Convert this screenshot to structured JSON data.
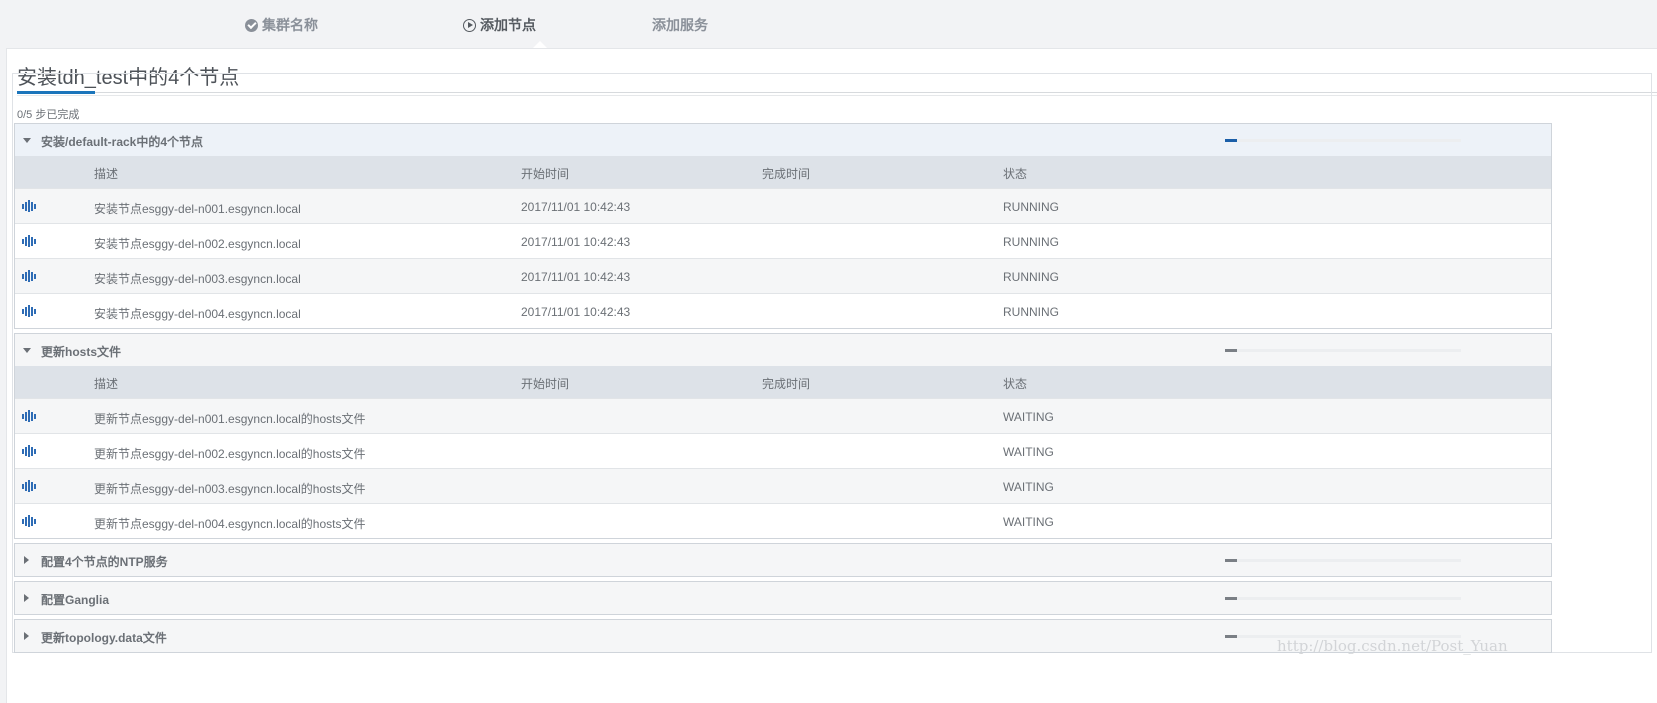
{
  "wizard": {
    "steps": [
      {
        "label": "集群名称",
        "icon": "check-circle-icon"
      },
      {
        "label": "添加节点",
        "icon": "play-circle-icon"
      },
      {
        "label": "添加服务",
        "icon": ""
      }
    ]
  },
  "page": {
    "title": "安装tdh_test中的4个节点",
    "progress_text": "0/5 步已完成"
  },
  "table_headers": {
    "desc": "描述",
    "start": "开始时间",
    "end": "完成时间",
    "status": "状态"
  },
  "groups": [
    {
      "title": "安装/default-rack中的4个节点",
      "expanded": true,
      "progress": 0.05,
      "rows": [
        {
          "desc": "安装节点esggy-del-n001.esgyncn.local",
          "start": "2017/11/01 10:42:43",
          "end": "",
          "status": "RUNNING"
        },
        {
          "desc": "安装节点esggy-del-n002.esgyncn.local",
          "start": "2017/11/01 10:42:43",
          "end": "",
          "status": "RUNNING"
        },
        {
          "desc": "安装节点esggy-del-n003.esgyncn.local",
          "start": "2017/11/01 10:42:43",
          "end": "",
          "status": "RUNNING"
        },
        {
          "desc": "安装节点esggy-del-n004.esgyncn.local",
          "start": "2017/11/01 10:42:43",
          "end": "",
          "status": "RUNNING"
        }
      ]
    },
    {
      "title": "更新hosts文件",
      "expanded": true,
      "progress": 0.05,
      "rows": [
        {
          "desc": "更新节点esggy-del-n001.esgyncn.local的hosts文件",
          "start": "",
          "end": "",
          "status": "WAITING"
        },
        {
          "desc": "更新节点esggy-del-n002.esgyncn.local的hosts文件",
          "start": "",
          "end": "",
          "status": "WAITING"
        },
        {
          "desc": "更新节点esggy-del-n003.esgyncn.local的hosts文件",
          "start": "",
          "end": "",
          "status": "WAITING"
        },
        {
          "desc": "更新节点esggy-del-n004.esgyncn.local的hosts文件",
          "start": "",
          "end": "",
          "status": "WAITING"
        }
      ]
    },
    {
      "title": "配置4个节点的NTP服务",
      "expanded": false,
      "progress": 0.05
    },
    {
      "title": "配置Ganglia",
      "expanded": false,
      "progress": 0.05
    },
    {
      "title": "更新topology.data文件",
      "expanded": false,
      "progress": 0.05
    }
  ],
  "watermark": "http://blog.csdn.net/Post_Yuan",
  "colors": {
    "accent": "#1b75bb",
    "bar_active": "#1b5fa8",
    "bar_idle": "#7a7f85"
  }
}
